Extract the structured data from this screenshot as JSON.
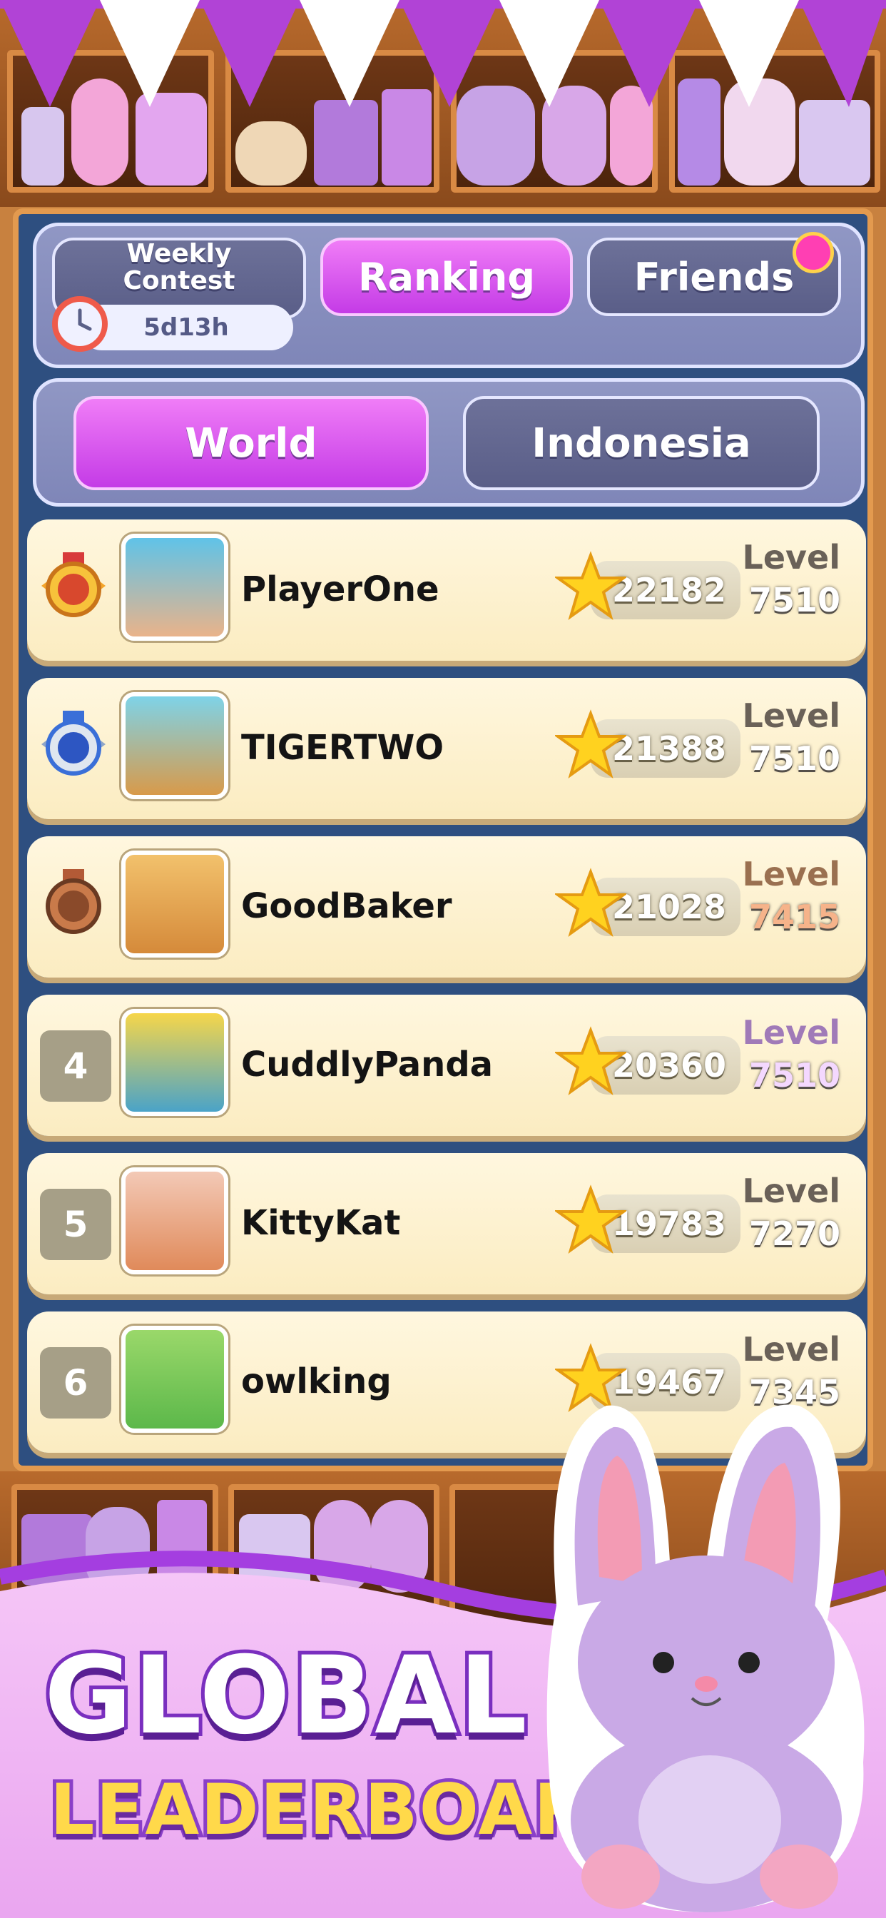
{
  "header": {
    "tabs": [
      {
        "label_line1": "Weekly",
        "label_line2": "Contest",
        "state": "inactive"
      },
      {
        "label": "Ranking",
        "state": "active"
      },
      {
        "label": "Friends",
        "state": "inactive"
      }
    ],
    "timer": "5d13h"
  },
  "scope_tabs": [
    {
      "label": "World",
      "state": "active"
    },
    {
      "label": "Indonesia",
      "state": "inactive"
    }
  ],
  "rows": [
    {
      "rank": "1",
      "name": "PlayerOne",
      "score": "22182",
      "level_label": "Level",
      "level": "7510"
    },
    {
      "rank": "2",
      "name": "TIGERTWO",
      "score": "21388",
      "level_label": "Level",
      "level": "7510"
    },
    {
      "rank": "3",
      "name": "GoodBaker",
      "score": "21028",
      "level_label": "Level",
      "level": "7415"
    },
    {
      "rank": "4",
      "name": "CuddlyPanda",
      "score": "20360",
      "level_label": "Level",
      "level": "7510"
    },
    {
      "rank": "5",
      "name": "KittyKat",
      "score": "19783",
      "level_label": "Level",
      "level": "7270"
    },
    {
      "rank": "6",
      "name": "owlking",
      "score": "19467",
      "level_label": "Level",
      "level": "7345"
    }
  ],
  "promo": {
    "line1": "GLOBAL",
    "line2": "LEADERBOARD"
  },
  "colors": {
    "active_tab": "#c43be6",
    "inactive_tab": "#5a5e88",
    "board": "#2e4f80",
    "row": "#fbecc1",
    "gold": "#ffd94a",
    "silver": "#3a6fd8",
    "bronze": "#b35a36"
  },
  "icons": {
    "clock": "clock-icon",
    "friends_badge": "notification-badge-icon",
    "star": "star-icon",
    "medals": [
      "gold-medal-icon",
      "silver-medal-icon",
      "bronze-medal-icon"
    ]
  }
}
